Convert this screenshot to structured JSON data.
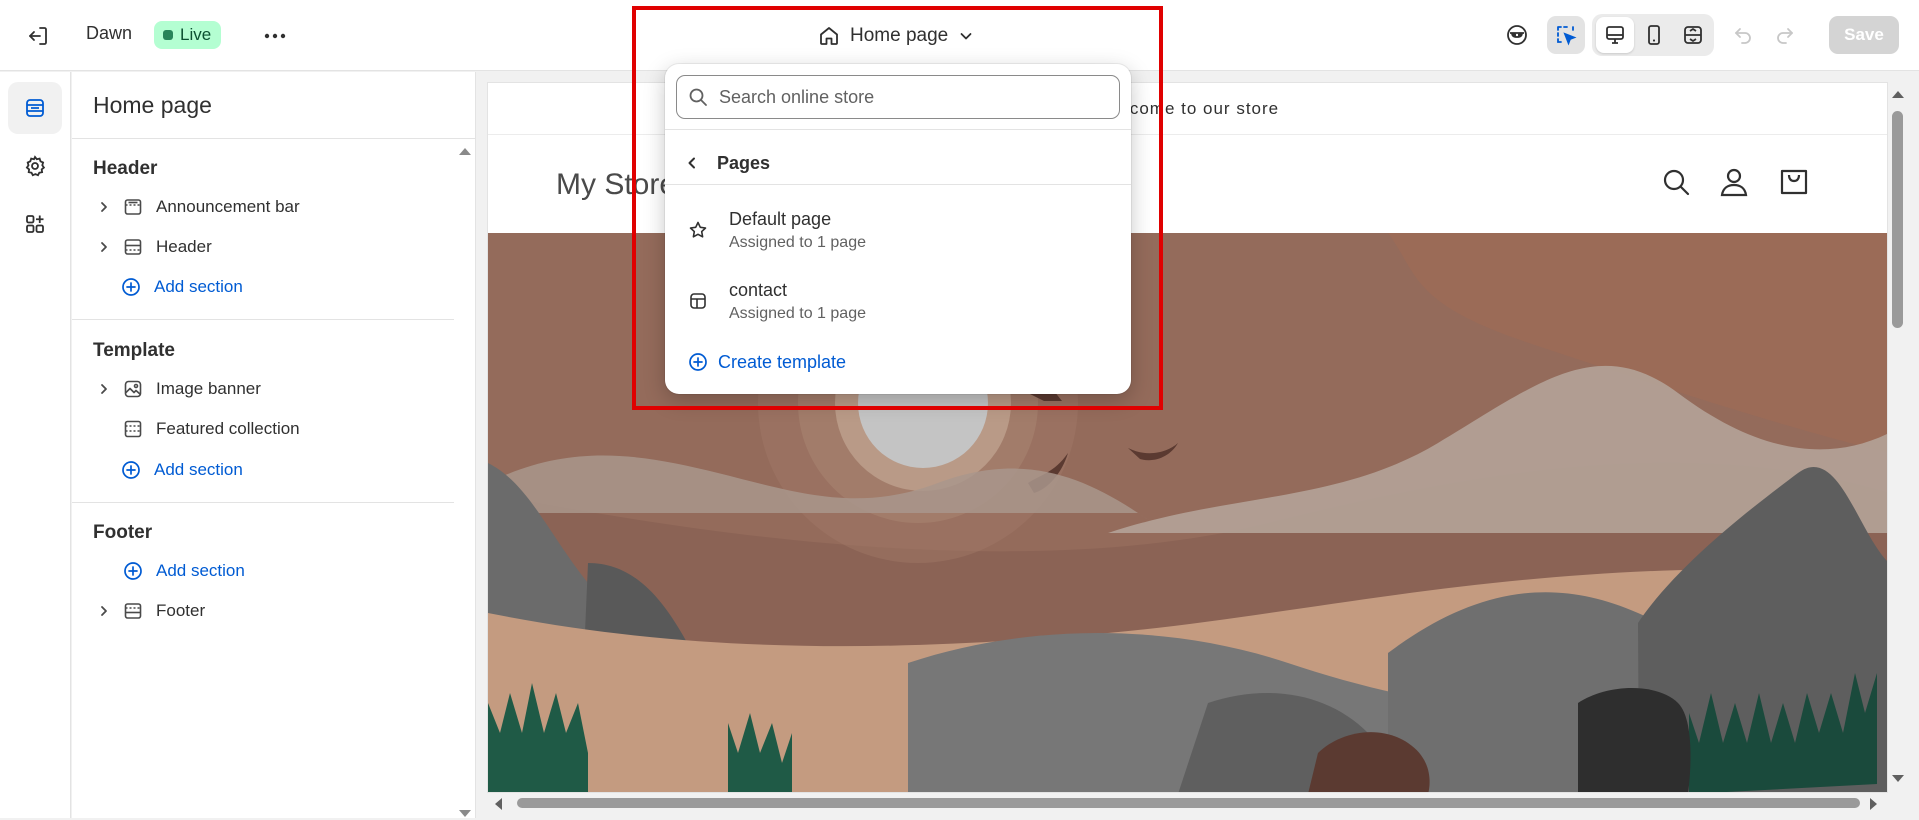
{
  "topbar": {
    "theme_name": "Dawn",
    "status_badge": "Live",
    "page_selector": "Home page",
    "save_label": "Save"
  },
  "sidebar": {
    "title": "Home page",
    "groups": [
      {
        "title": "Header",
        "items": [
          {
            "label": "Announcement bar",
            "icon": "announcement-bar-icon"
          },
          {
            "label": "Header",
            "icon": "header-section-icon"
          }
        ],
        "add_label": "Add section"
      },
      {
        "title": "Template",
        "items": [
          {
            "label": "Image banner",
            "icon": "image-icon"
          },
          {
            "label": "Featured collection",
            "icon": "collection-icon"
          }
        ],
        "add_label": "Add section"
      },
      {
        "title": "Footer",
        "items": [
          {
            "label": "Footer",
            "icon": "footer-section-icon"
          }
        ],
        "add_label": "Add section"
      }
    ]
  },
  "dropdown": {
    "search_placeholder": "Search online store",
    "back_label": "Pages",
    "options": [
      {
        "title": "Default page",
        "subtitle": "Assigned to 1 page",
        "icon": "star-icon"
      },
      {
        "title": "contact",
        "subtitle": "Assigned to 1 page",
        "icon": "template-icon"
      }
    ],
    "create_label": "Create template"
  },
  "preview": {
    "announcement_text": "Welcome to our store",
    "store_name": "My Store"
  },
  "colors": {
    "accent": "#005bd3",
    "live_badge_bg": "#b4fed2",
    "highlight_border": "#e00000"
  }
}
